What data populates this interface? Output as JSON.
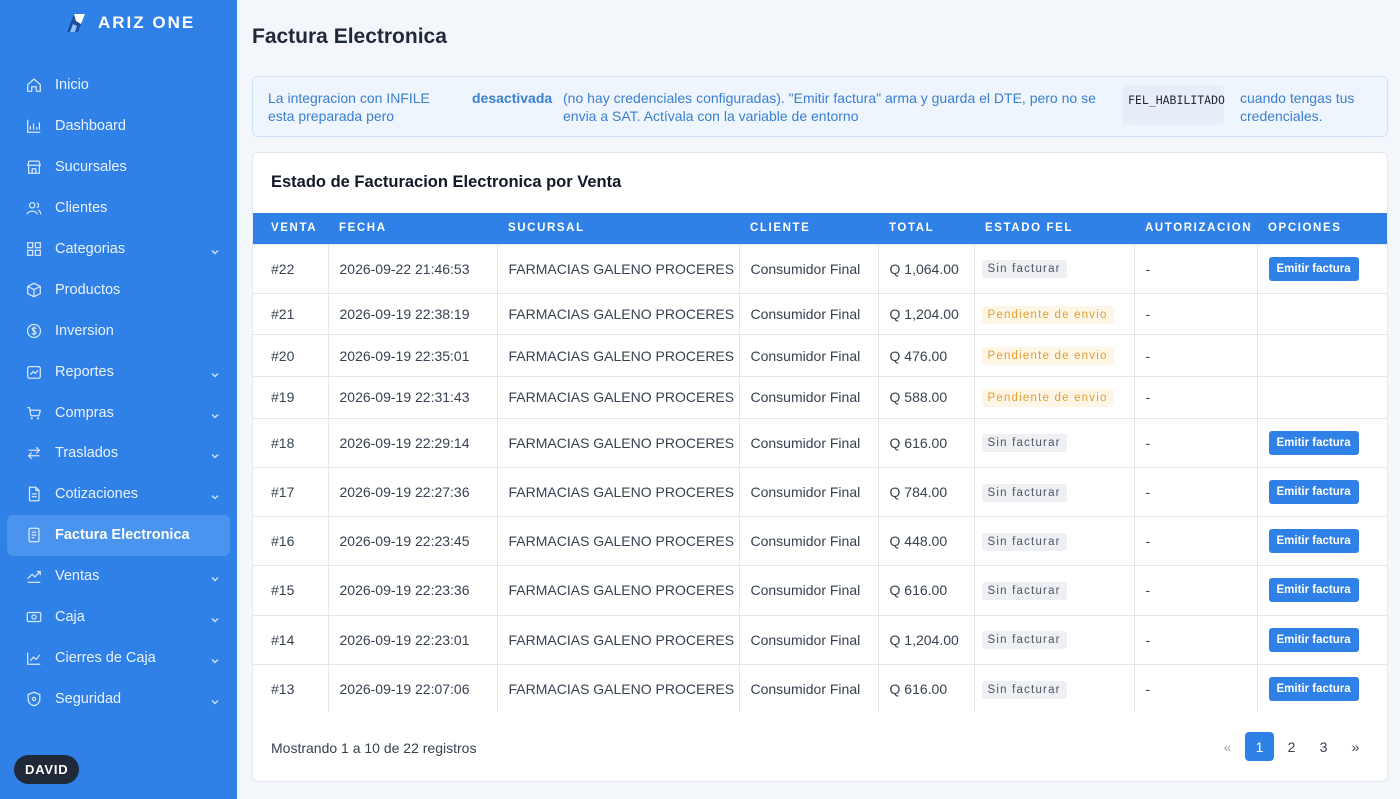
{
  "brand": {
    "name": "ARIZ ONE"
  },
  "sidebar": {
    "items": [
      {
        "label": "Inicio",
        "icon": "home-icon",
        "chevron": false
      },
      {
        "label": "Dashboard",
        "icon": "chart-icon",
        "chevron": false
      },
      {
        "label": "Sucursales",
        "icon": "store-icon",
        "chevron": false
      },
      {
        "label": "Clientes",
        "icon": "users-icon",
        "chevron": false
      },
      {
        "label": "Categorias",
        "icon": "grid-icon",
        "chevron": true
      },
      {
        "label": "Productos",
        "icon": "box-icon",
        "chevron": false
      },
      {
        "label": "Inversion",
        "icon": "dollar-icon",
        "chevron": false
      },
      {
        "label": "Reportes",
        "icon": "report-icon",
        "chevron": true
      },
      {
        "label": "Compras",
        "icon": "cart-icon",
        "chevron": true
      },
      {
        "label": "Traslados",
        "icon": "transfer-icon",
        "chevron": true
      },
      {
        "label": "Cotizaciones",
        "icon": "document-icon",
        "chevron": true
      },
      {
        "label": "Factura Electronica",
        "icon": "invoice-icon",
        "chevron": false,
        "active": true
      },
      {
        "label": "Ventas",
        "icon": "sales-icon",
        "chevron": true
      },
      {
        "label": "Caja",
        "icon": "cash-icon",
        "chevron": true
      },
      {
        "label": "Cierres de Caja",
        "icon": "close-cash-icon",
        "chevron": true
      },
      {
        "label": "Seguridad",
        "icon": "shield-icon",
        "chevron": true
      }
    ],
    "user": "DAVID"
  },
  "page": {
    "title": "Factura Electronica"
  },
  "alert": {
    "part1": "La integracion con INFILE esta preparada pero",
    "emphasis": "desactivada",
    "part2": "(no hay credenciales configuradas). \"Emitir factura\" arma y guarda el DTE, pero no se envia a SAT. Actívala con la variable de entorno",
    "code": "FEL_HABILITADO",
    "part3": "cuando tengas tus credenciales."
  },
  "table": {
    "title": "Estado de Facturacion Electronica por Venta",
    "headers": [
      "VENTA",
      "FECHA",
      "SUCURSAL",
      "CLIENTE",
      "TOTAL",
      "ESTADO FEL",
      "AUTORIZACION",
      "OPCIONES"
    ],
    "rows": [
      {
        "venta": "#22",
        "fecha": "2026-09-22 21:46:53",
        "sucursal": "FARMACIAS GALENO PROCERES",
        "cliente": "Consumidor Final",
        "total": "Q 1,064.00",
        "estado": "Sin facturar",
        "autorizacion": "-",
        "opcion": "Emitir factura"
      },
      {
        "venta": "#21",
        "fecha": "2026-09-19 22:38:19",
        "sucursal": "FARMACIAS GALENO PROCERES",
        "cliente": "Consumidor Final",
        "total": "Q 1,204.00",
        "estado": "Pendiente de envio",
        "autorizacion": "-",
        "opcion": ""
      },
      {
        "venta": "#20",
        "fecha": "2026-09-19 22:35:01",
        "sucursal": "FARMACIAS GALENO PROCERES",
        "cliente": "Consumidor Final",
        "total": "Q 476.00",
        "estado": "Pendiente de envio",
        "autorizacion": "-",
        "opcion": ""
      },
      {
        "venta": "#19",
        "fecha": "2026-09-19 22:31:43",
        "sucursal": "FARMACIAS GALENO PROCERES",
        "cliente": "Consumidor Final",
        "total": "Q 588.00",
        "estado": "Pendiente de envio",
        "autorizacion": "-",
        "opcion": ""
      },
      {
        "venta": "#18",
        "fecha": "2026-09-19 22:29:14",
        "sucursal": "FARMACIAS GALENO PROCERES",
        "cliente": "Consumidor Final",
        "total": "Q 616.00",
        "estado": "Sin facturar",
        "autorizacion": "-",
        "opcion": "Emitir factura"
      },
      {
        "venta": "#17",
        "fecha": "2026-09-19 22:27:36",
        "sucursal": "FARMACIAS GALENO PROCERES",
        "cliente": "Consumidor Final",
        "total": "Q 784.00",
        "estado": "Sin facturar",
        "autorizacion": "-",
        "opcion": "Emitir factura"
      },
      {
        "venta": "#16",
        "fecha": "2026-09-19 22:23:45",
        "sucursal": "FARMACIAS GALENO PROCERES",
        "cliente": "Consumidor Final",
        "total": "Q 448.00",
        "estado": "Sin facturar",
        "autorizacion": "-",
        "opcion": "Emitir factura"
      },
      {
        "venta": "#15",
        "fecha": "2026-09-19 22:23:36",
        "sucursal": "FARMACIAS GALENO PROCERES",
        "cliente": "Consumidor Final",
        "total": "Q 616.00",
        "estado": "Sin facturar",
        "autorizacion": "-",
        "opcion": "Emitir factura"
      },
      {
        "venta": "#14",
        "fecha": "2026-09-19 22:23:01",
        "sucursal": "FARMACIAS GALENO PROCERES",
        "cliente": "Consumidor Final",
        "total": "Q 1,204.00",
        "estado": "Sin facturar",
        "autorizacion": "-",
        "opcion": "Emitir factura"
      },
      {
        "venta": "#13",
        "fecha": "2026-09-19 22:07:06",
        "sucursal": "FARMACIAS GALENO PROCERES",
        "cliente": "Consumidor Final",
        "total": "Q 616.00",
        "estado": "Sin facturar",
        "autorizacion": "-",
        "opcion": "Emitir factura"
      }
    ],
    "footer": "Mostrando 1 a 10 de 22 registros"
  },
  "pagination": {
    "prev": "«",
    "pages": [
      "1",
      "2",
      "3"
    ],
    "current": "1",
    "next": "»"
  },
  "colors": {
    "primary": "#2f80e7",
    "pending": "#e0a033",
    "neutral_badge": "#eef0f3"
  }
}
